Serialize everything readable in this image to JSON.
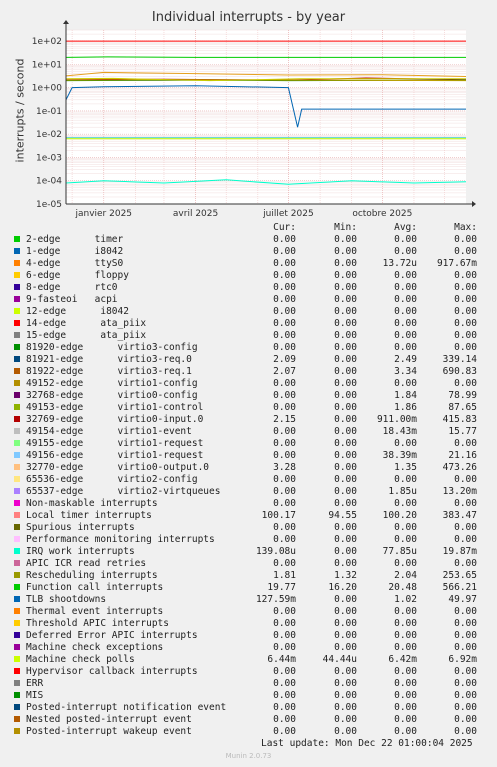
{
  "title": "Individual interrupts - by year",
  "watermark": "RRDTOOL / TOBI OETIKER",
  "footer": "Munin 2.0.73",
  "last_update": "Last update: Mon Dec 22 01:00:04 2025",
  "legend_header": {
    "cur": "Cur:",
    "min": "Min:",
    "avg": "Avg:",
    "max": "Max:"
  },
  "chart_data": {
    "type": "line",
    "title": "Individual interrupts - by year",
    "ylabel": "interrupts / second",
    "xlabel": "",
    "y_scale": "log",
    "ylim": [
      1e-05,
      300
    ],
    "y_ticks": [
      {
        "v": 100,
        "label": "1e+02"
      },
      {
        "v": 10,
        "label": "1e+01"
      },
      {
        "v": 1,
        "label": "1e+00"
      },
      {
        "v": 0.1,
        "label": "1e-01"
      },
      {
        "v": 0.01,
        "label": "1e-02"
      },
      {
        "v": 0.001,
        "label": "1e-03"
      },
      {
        "v": 0.0001,
        "label": "1e-04"
      },
      {
        "v": 1e-05,
        "label": "1e-05"
      }
    ],
    "x_range": [
      "2024-11-25",
      "2025-12-22"
    ],
    "x_ticks": [
      {
        "date": "2025-01-01",
        "label": "janvier 2025"
      },
      {
        "date": "2025-04-01",
        "label": "avril 2025"
      },
      {
        "date": "2025-07-01",
        "label": "juillet 2025"
      },
      {
        "date": "2025-10-01",
        "label": "octobre 2025"
      }
    ],
    "grid": true,
    "series": [
      {
        "name": "Local timer interrupts",
        "color": "#ff0000",
        "points": [
          [
            "2024-11-25",
            100
          ],
          [
            "2025-03-01",
            100
          ],
          [
            "2025-07-01",
            100
          ],
          [
            "2025-12-22",
            100
          ]
        ]
      },
      {
        "name": "Function call interrupts",
        "color": "#00cc00",
        "points": [
          [
            "2024-11-25",
            20
          ],
          [
            "2025-01-05",
            21
          ],
          [
            "2025-04-01",
            20
          ],
          [
            "2025-07-01",
            20
          ],
          [
            "2025-10-01",
            20
          ],
          [
            "2025-12-22",
            20
          ]
        ]
      },
      {
        "name": "14-edge",
        "color": "#e6a020",
        "points": [
          [
            "2024-11-25",
            3.2
          ],
          [
            "2025-01-01",
            4.5
          ],
          [
            "2025-04-01",
            4
          ],
          [
            "2025-07-01",
            3.5
          ],
          [
            "2025-10-01",
            3.6
          ],
          [
            "2025-12-22",
            3
          ]
        ]
      },
      {
        "name": "32769-edge",
        "color": "#b00000",
        "points": [
          [
            "2024-11-25",
            2.2
          ],
          [
            "2025-03-01",
            2.3
          ],
          [
            "2025-07-01",
            2.1
          ],
          [
            "2025-09-15",
            2.6
          ],
          [
            "2025-12-22",
            2.2
          ]
        ]
      },
      {
        "name": "81921-edge",
        "color": "#008000",
        "points": [
          [
            "2024-11-25",
            2.0
          ],
          [
            "2025-04-01",
            2.1
          ],
          [
            "2025-07-01",
            2.0
          ],
          [
            "2025-12-22",
            2.1
          ]
        ]
      },
      {
        "name": "81922-edge",
        "color": "#c0a000",
        "points": [
          [
            "2024-11-25",
            2.1
          ],
          [
            "2025-04-01",
            2.2
          ],
          [
            "2025-07-01",
            2.1
          ],
          [
            "2025-12-22",
            2.0
          ]
        ]
      },
      {
        "name": "32768-edge",
        "color": "#cccc00",
        "points": [
          [
            "2024-11-25",
            2.4
          ],
          [
            "2025-01-10",
            2.5
          ],
          [
            "2025-04-15",
            2.0
          ],
          [
            "2025-07-12",
            2.4
          ],
          [
            "2025-12-22",
            2.4
          ]
        ]
      },
      {
        "name": "TLB shootdowns",
        "color": "#0066b3",
        "points": [
          [
            "2024-11-25",
            0.3
          ],
          [
            "2024-12-01",
            1.0
          ],
          [
            "2025-01-01",
            1.1
          ],
          [
            "2025-04-01",
            1.2
          ],
          [
            "2025-07-01",
            1.0
          ],
          [
            "2025-07-10",
            0.02
          ],
          [
            "2025-07-14",
            0.12
          ],
          [
            "2025-10-01",
            0.12
          ],
          [
            "2025-12-22",
            0.12
          ]
        ]
      },
      {
        "name": "Hypervisor callback interrupts",
        "color": "#3fcccc",
        "points": [
          [
            "2024-11-25",
            0.007
          ],
          [
            "2025-06-01",
            0.007
          ],
          [
            "2025-12-22",
            0.007
          ]
        ]
      },
      {
        "name": "Machine check polls",
        "color": "#ccff00",
        "points": [
          [
            "2024-11-25",
            0.0064
          ],
          [
            "2025-06-01",
            0.0064
          ],
          [
            "2025-12-22",
            0.0064
          ]
        ]
      },
      {
        "name": "IRQ work interrupts",
        "color": "#00ffcc",
        "points": [
          [
            "2024-11-25",
            8e-05
          ],
          [
            "2025-01-01",
            0.0001
          ],
          [
            "2025-03-01",
            8e-05
          ],
          [
            "2025-05-01",
            0.00011
          ],
          [
            "2025-07-01",
            7e-05
          ],
          [
            "2025-09-01",
            0.0001
          ],
          [
            "2025-11-01",
            8e-05
          ],
          [
            "2025-12-22",
            9e-05
          ]
        ]
      }
    ]
  },
  "legend": [
    {
      "name": "2-edge      timer",
      "color": "#00cc00",
      "cur": "0.00",
      "min": "0.00",
      "avg": "0.00",
      "max": "0.00"
    },
    {
      "name": "1-edge      i8042",
      "color": "#0066b3",
      "cur": "0.00",
      "min": "0.00",
      "avg": "0.00",
      "max": "0.00"
    },
    {
      "name": "4-edge      ttyS0",
      "color": "#ff8000",
      "cur": "0.00",
      "min": "0.00",
      "avg": "13.72u",
      "max": "917.67m"
    },
    {
      "name": "6-edge      floppy",
      "color": "#ffcc00",
      "cur": "0.00",
      "min": "0.00",
      "avg": "0.00",
      "max": "0.00"
    },
    {
      "name": "8-edge      rtc0",
      "color": "#330099",
      "cur": "0.00",
      "min": "0.00",
      "avg": "0.00",
      "max": "0.00"
    },
    {
      "name": "9-fasteoi   acpi",
      "color": "#990099",
      "cur": "0.00",
      "min": "0.00",
      "avg": "0.00",
      "max": "0.00"
    },
    {
      "name": "12-edge      i8042",
      "color": "#ccff00",
      "cur": "0.00",
      "min": "0.00",
      "avg": "0.00",
      "max": "0.00"
    },
    {
      "name": "14-edge      ata_piix",
      "color": "#ff0000",
      "cur": "0.00",
      "min": "0.00",
      "avg": "0.00",
      "max": "0.00"
    },
    {
      "name": "15-edge      ata_piix",
      "color": "#808080",
      "cur": "0.00",
      "min": "0.00",
      "avg": "0.00",
      "max": "0.00"
    },
    {
      "name": "81920-edge      virtio3-config",
      "color": "#008f00",
      "cur": "0.00",
      "min": "0.00",
      "avg": "0.00",
      "max": "0.00"
    },
    {
      "name": "81921-edge      virtio3-req.0",
      "color": "#00487d",
      "cur": "2.09",
      "min": "0.00",
      "avg": "2.49",
      "max": "339.14"
    },
    {
      "name": "81922-edge      virtio3-req.1",
      "color": "#b35a00",
      "cur": "2.07",
      "min": "0.00",
      "avg": "3.34",
      "max": "690.83"
    },
    {
      "name": "49152-edge      virtio1-config",
      "color": "#b38f00",
      "cur": "0.00",
      "min": "0.00",
      "avg": "0.00",
      "max": "0.00"
    },
    {
      "name": "32768-edge      virtio0-config",
      "color": "#6b006b",
      "cur": "0.00",
      "min": "0.00",
      "avg": "1.84",
      "max": "78.99"
    },
    {
      "name": "49153-edge      virtio1-control",
      "color": "#8fb300",
      "cur": "0.00",
      "min": "0.00",
      "avg": "1.86",
      "max": "87.65"
    },
    {
      "name": "32769-edge      virtio0-input.0",
      "color": "#b30000",
      "cur": "2.15",
      "min": "0.00",
      "avg": "911.00m",
      "max": "415.83"
    },
    {
      "name": "49154-edge      virtio1-event",
      "color": "#bebebe",
      "cur": "0.00",
      "min": "0.00",
      "avg": "18.43m",
      "max": "15.77"
    },
    {
      "name": "49155-edge      virtio1-request",
      "color": "#80ff80",
      "cur": "0.00",
      "min": "0.00",
      "avg": "0.00",
      "max": "0.00"
    },
    {
      "name": "49156-edge      virtio1-request",
      "color": "#80c9ff",
      "cur": "0.00",
      "min": "0.00",
      "avg": "38.39m",
      "max": "21.16"
    },
    {
      "name": "32770-edge      virtio0-output.0",
      "color": "#ffc080",
      "cur": "3.28",
      "min": "0.00",
      "avg": "1.35",
      "max": "473.26"
    },
    {
      "name": "65536-edge      virtio2-config",
      "color": "#ffe680",
      "cur": "0.00",
      "min": "0.00",
      "avg": "0.00",
      "max": "0.00"
    },
    {
      "name": "65537-edge      virtio2-virtqueues",
      "color": "#aa80ff",
      "cur": "0.00",
      "min": "0.00",
      "avg": "1.85u",
      "max": "13.20m"
    },
    {
      "name": "Non-maskable interrupts",
      "color": "#ee00cc",
      "cur": "0.00",
      "min": "0.00",
      "avg": "0.00",
      "max": "0.00"
    },
    {
      "name": "Local timer interrupts",
      "color": "#ff8080",
      "cur": "100.17",
      "min": "94.55",
      "avg": "100.20",
      "max": "383.47"
    },
    {
      "name": "Spurious interrupts",
      "color": "#666600",
      "cur": "0.00",
      "min": "0.00",
      "avg": "0.00",
      "max": "0.00"
    },
    {
      "name": "Performance monitoring interrupts",
      "color": "#ffbfff",
      "cur": "0.00",
      "min": "0.00",
      "avg": "0.00",
      "max": "0.00"
    },
    {
      "name": "IRQ work interrupts",
      "color": "#00ffcc",
      "cur": "139.08u",
      "min": "0.00",
      "avg": "77.85u",
      "max": "19.87m"
    },
    {
      "name": "APIC ICR read retries",
      "color": "#cc6699",
      "cur": "0.00",
      "min": "0.00",
      "avg": "0.00",
      "max": "0.00"
    },
    {
      "name": "Rescheduling interrupts",
      "color": "#999900",
      "cur": "1.81",
      "min": "1.32",
      "avg": "2.04",
      "max": "253.65"
    },
    {
      "name": "Function call interrupts",
      "color": "#00cc00",
      "cur": "19.77",
      "min": "16.20",
      "avg": "20.48",
      "max": "566.21"
    },
    {
      "name": "TLB shootdowns",
      "color": "#0066b3",
      "cur": "127.59m",
      "min": "0.00",
      "avg": "1.02",
      "max": "49.97"
    },
    {
      "name": "Thermal event interrupts",
      "color": "#ff8000",
      "cur": "0.00",
      "min": "0.00",
      "avg": "0.00",
      "max": "0.00"
    },
    {
      "name": "Threshold APIC interrupts",
      "color": "#ffcc00",
      "cur": "0.00",
      "min": "0.00",
      "avg": "0.00",
      "max": "0.00"
    },
    {
      "name": "Deferred Error APIC interrupts",
      "color": "#330099",
      "cur": "0.00",
      "min": "0.00",
      "avg": "0.00",
      "max": "0.00"
    },
    {
      "name": "Machine check exceptions",
      "color": "#990099",
      "cur": "0.00",
      "min": "0.00",
      "avg": "0.00",
      "max": "0.00"
    },
    {
      "name": "Machine check polls",
      "color": "#ccff00",
      "cur": "6.44m",
      "min": "44.44u",
      "avg": "6.42m",
      "max": "6.92m"
    },
    {
      "name": "Hypervisor callback interrupts",
      "color": "#ff0000",
      "cur": "0.00",
      "min": "0.00",
      "avg": "0.00",
      "max": "0.00"
    },
    {
      "name": "ERR",
      "color": "#808080",
      "cur": "0.00",
      "min": "0.00",
      "avg": "0.00",
      "max": "0.00"
    },
    {
      "name": "MIS",
      "color": "#008f00",
      "cur": "0.00",
      "min": "0.00",
      "avg": "0.00",
      "max": "0.00"
    },
    {
      "name": "Posted-interrupt notification event",
      "color": "#00487d",
      "cur": "0.00",
      "min": "0.00",
      "avg": "0.00",
      "max": "0.00"
    },
    {
      "name": "Nested posted-interrupt event",
      "color": "#b35a00",
      "cur": "0.00",
      "min": "0.00",
      "avg": "0.00",
      "max": "0.00"
    },
    {
      "name": "Posted-interrupt wakeup event",
      "color": "#b38f00",
      "cur": "0.00",
      "min": "0.00",
      "avg": "0.00",
      "max": "0.00"
    }
  ]
}
